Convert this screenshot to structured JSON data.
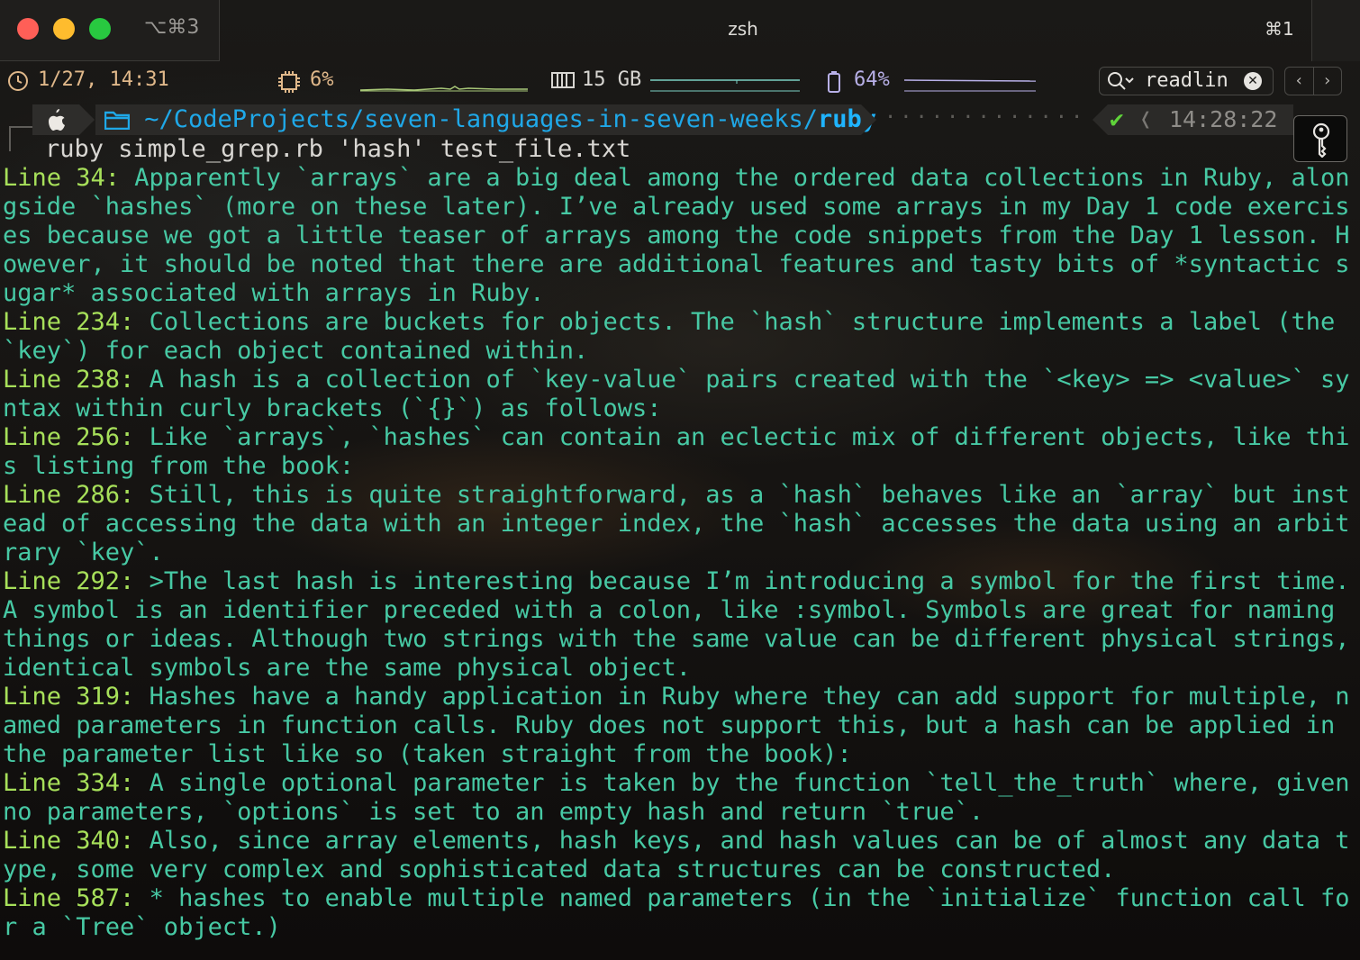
{
  "titlebar": {
    "tab_shortcut_left": "⌥⌘3",
    "title": "zsh",
    "tab_shortcut_right": "⌘1"
  },
  "statusbar": {
    "clock_icon": "clock-icon",
    "datetime": "1/27, 14:31",
    "cpu_icon": "cpu-chip-icon",
    "cpu": "6%",
    "memory_icon": "memory-icon",
    "memory": "15 GB",
    "battery_icon": "battery-icon",
    "battery": "64%",
    "search": {
      "value": "readlin",
      "icon": "search-icon"
    }
  },
  "prompt": {
    "os_icon": "apple-icon",
    "folder_icon": "folder-icon",
    "path_prefix": "~/CodeProjects/seven-languages-in-seven-weeks/",
    "path_current": "ruby",
    "status_icon": "checkmark-icon",
    "time": "14:28:22"
  },
  "command": "ruby simple_grep.rb 'hash' test_file.txt",
  "output": [
    {
      "prefix": "Line 34:",
      "text": " Apparently `arrays` are a big deal among the ordered data collections in Ruby, alongside `hashes` (more on these later). I’ve already used some arrays in my Day 1 code exercises because we got a little teaser of arrays among the code snippets from the Day 1 lesson. However, it should be noted that there are additional features and tasty bits of *syntactic sugar* associated with arrays in Ruby."
    },
    {
      "prefix": "Line 234:",
      "text": " Collections are buckets for objects. The `hash` structure implements a label (the `key`) for each object contained within."
    },
    {
      "prefix": "Line 238:",
      "text": " A hash is a collection of `key-value` pairs created with the `<key> => <value>` syntax within curly brackets (`{}`) as follows:"
    },
    {
      "prefix": "Line 256:",
      "text": " Like `arrays`, `hashes` can contain an eclectic mix of different objects, like this listing from the book:"
    },
    {
      "prefix": "Line 286:",
      "text": " Still, this is quite straightforward, as a `hash` behaves like an `array` but instead of accessing the data with an integer index, the `hash` accesses the data using an arbitrary `key`."
    },
    {
      "prefix": "Line 292:",
      "text": " >The last hash is interesting because I’m introducing a symbol for the first time. A symbol is an identifier preceded with a colon, like :symbol. Symbols are great for naming things or ideas. Although two strings with the same value can be different physical strings, identical symbols are the same physical object."
    },
    {
      "prefix": "Line 319:",
      "text": " Hashes have a handy application in Ruby where they can add support for multiple, named parameters in function calls. Ruby does not support this, but a hash can be applied in the parameter list like so (taken straight from the book):"
    },
    {
      "prefix": "Line 334:",
      "text": " A single optional parameter is taken by the function `tell_the_truth` where, given no parameters, `options` is set to an empty hash and return `true`."
    },
    {
      "prefix": "Line 340:",
      "text": " Also, since array elements, hash keys, and hash values can be of almost any data type, some very complex and sophisticated data structures can be constructed."
    },
    {
      "prefix": "Line 587:",
      "text": " * hashes to enable multiple named parameters (in the `initialize` function call for a `Tree` object.)"
    }
  ]
}
